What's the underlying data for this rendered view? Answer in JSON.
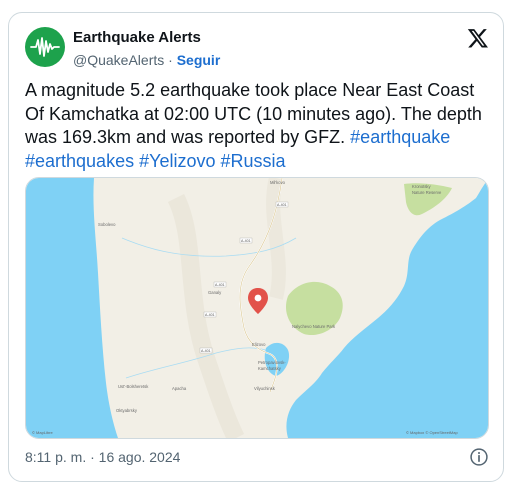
{
  "author": {
    "display_name": "Earthquake Alerts",
    "handle": "@QuakeAlerts",
    "separator": "·",
    "follow_label": "Seguir",
    "avatar_icon": "seismograph-icon",
    "avatar_color": "#1da24c"
  },
  "tweet": {
    "text_plain": "A magnitude 5.2 earthquake took place Near East Coast Of Kamchatka at 02:00 UTC (10 minutes ago). The depth was 169.3km and was reported by GFZ.",
    "hashtags": [
      "#earthquake",
      "#earthquakes",
      "#Yelizovo",
      "#Russia"
    ]
  },
  "map": {
    "labels": {
      "milkovo": "Mil'kovo",
      "kronotsky": "Kronotsky",
      "nature_reserve": "Nature Reserve",
      "sobolevo": "Sobolevo",
      "ganaly": "Ganaly",
      "nalychevo": "Nalychevo Nature Park",
      "yelizovo": "Elizovo",
      "petropavlovsk": "Petropavlovsk-",
      "kamchatsky": "Kamchatsky",
      "vilyuchinsk": "Vilyuchinsk",
      "ust_bolsheretsk": "Ust'-Bolsheretsk",
      "apacha": "Apacha",
      "oktyabrsky": "Oktyabrsky",
      "road_401": "A-401",
      "attribution_left": "© MapLibre",
      "attribution_right": "© Mapbox © OpenStreetMap"
    },
    "colors": {
      "land": "#f2efe6",
      "water": "#7fd1f5",
      "park": "#c6dfa0",
      "pin": "#e2524a"
    }
  },
  "footer": {
    "timestamp": "8:11 p. m. · 16 ago. 2024",
    "info_icon": "info-icon"
  },
  "brand": {
    "logo_icon": "x-logo-icon"
  }
}
